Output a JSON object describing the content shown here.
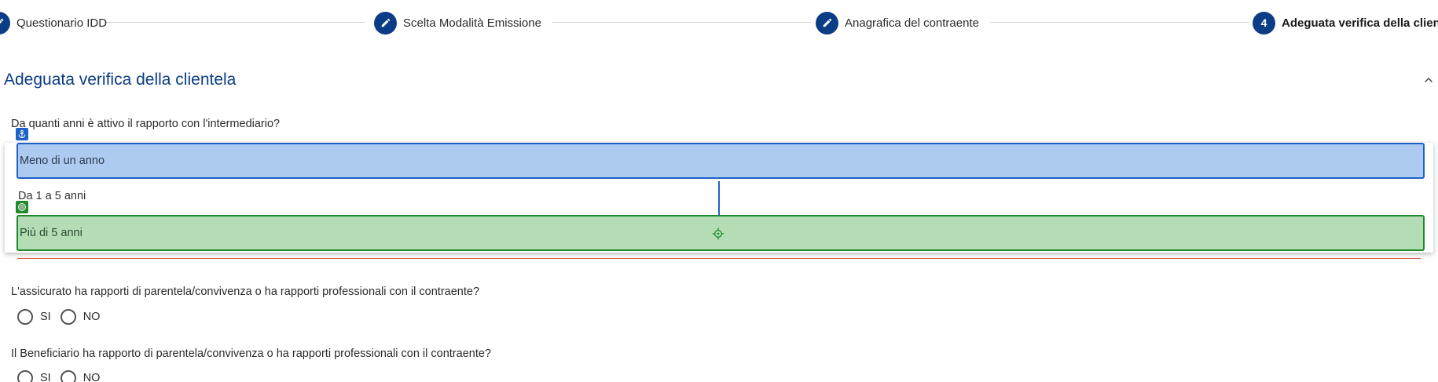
{
  "stepper": {
    "steps": [
      {
        "icon": "pencil-icon",
        "label": "Questionario IDD",
        "active": false
      },
      {
        "icon": "pencil-icon",
        "label": "Scelta Modalità Emissione",
        "active": false
      },
      {
        "icon": "pencil-icon",
        "label": "Anagrafica del contraente",
        "active": false
      },
      {
        "number": "4",
        "label": "Adeguata verifica della clientela",
        "active": true
      }
    ]
  },
  "section": {
    "title": "Adeguata verifica della clientela",
    "collapse_icon": "chevron-up-icon"
  },
  "questions": {
    "q1": {
      "text": "Da quanti anni è attivo il rapporto con l'intermediario?",
      "options": [
        "Meno di un anno",
        "Da 1 a 5 anni",
        "Più di 5 anni"
      ]
    },
    "q2": {
      "text": "L'assicurato ha rapporti di parentela/convivenza o ha rapporti professionali con il contraente?",
      "yes": "SI",
      "no": "NO"
    },
    "q3": {
      "text": "Il Beneficiario ha rapporto di parentela/convivenza o ha rapporti professionali con il contraente?",
      "yes": "SI",
      "no": "NO"
    }
  },
  "overlay": {
    "anchor_icon": "anchor-icon",
    "target_icon": "target-icon",
    "crosshair_icon": "crosshair-icon"
  },
  "colors": {
    "primary": "#0b3d86",
    "anchor_fill": "#adcbf0",
    "anchor_border": "#1e62c8",
    "target_fill": "#b4ddb6",
    "target_border": "#1f8a2a",
    "error_line": "#e0554c"
  }
}
